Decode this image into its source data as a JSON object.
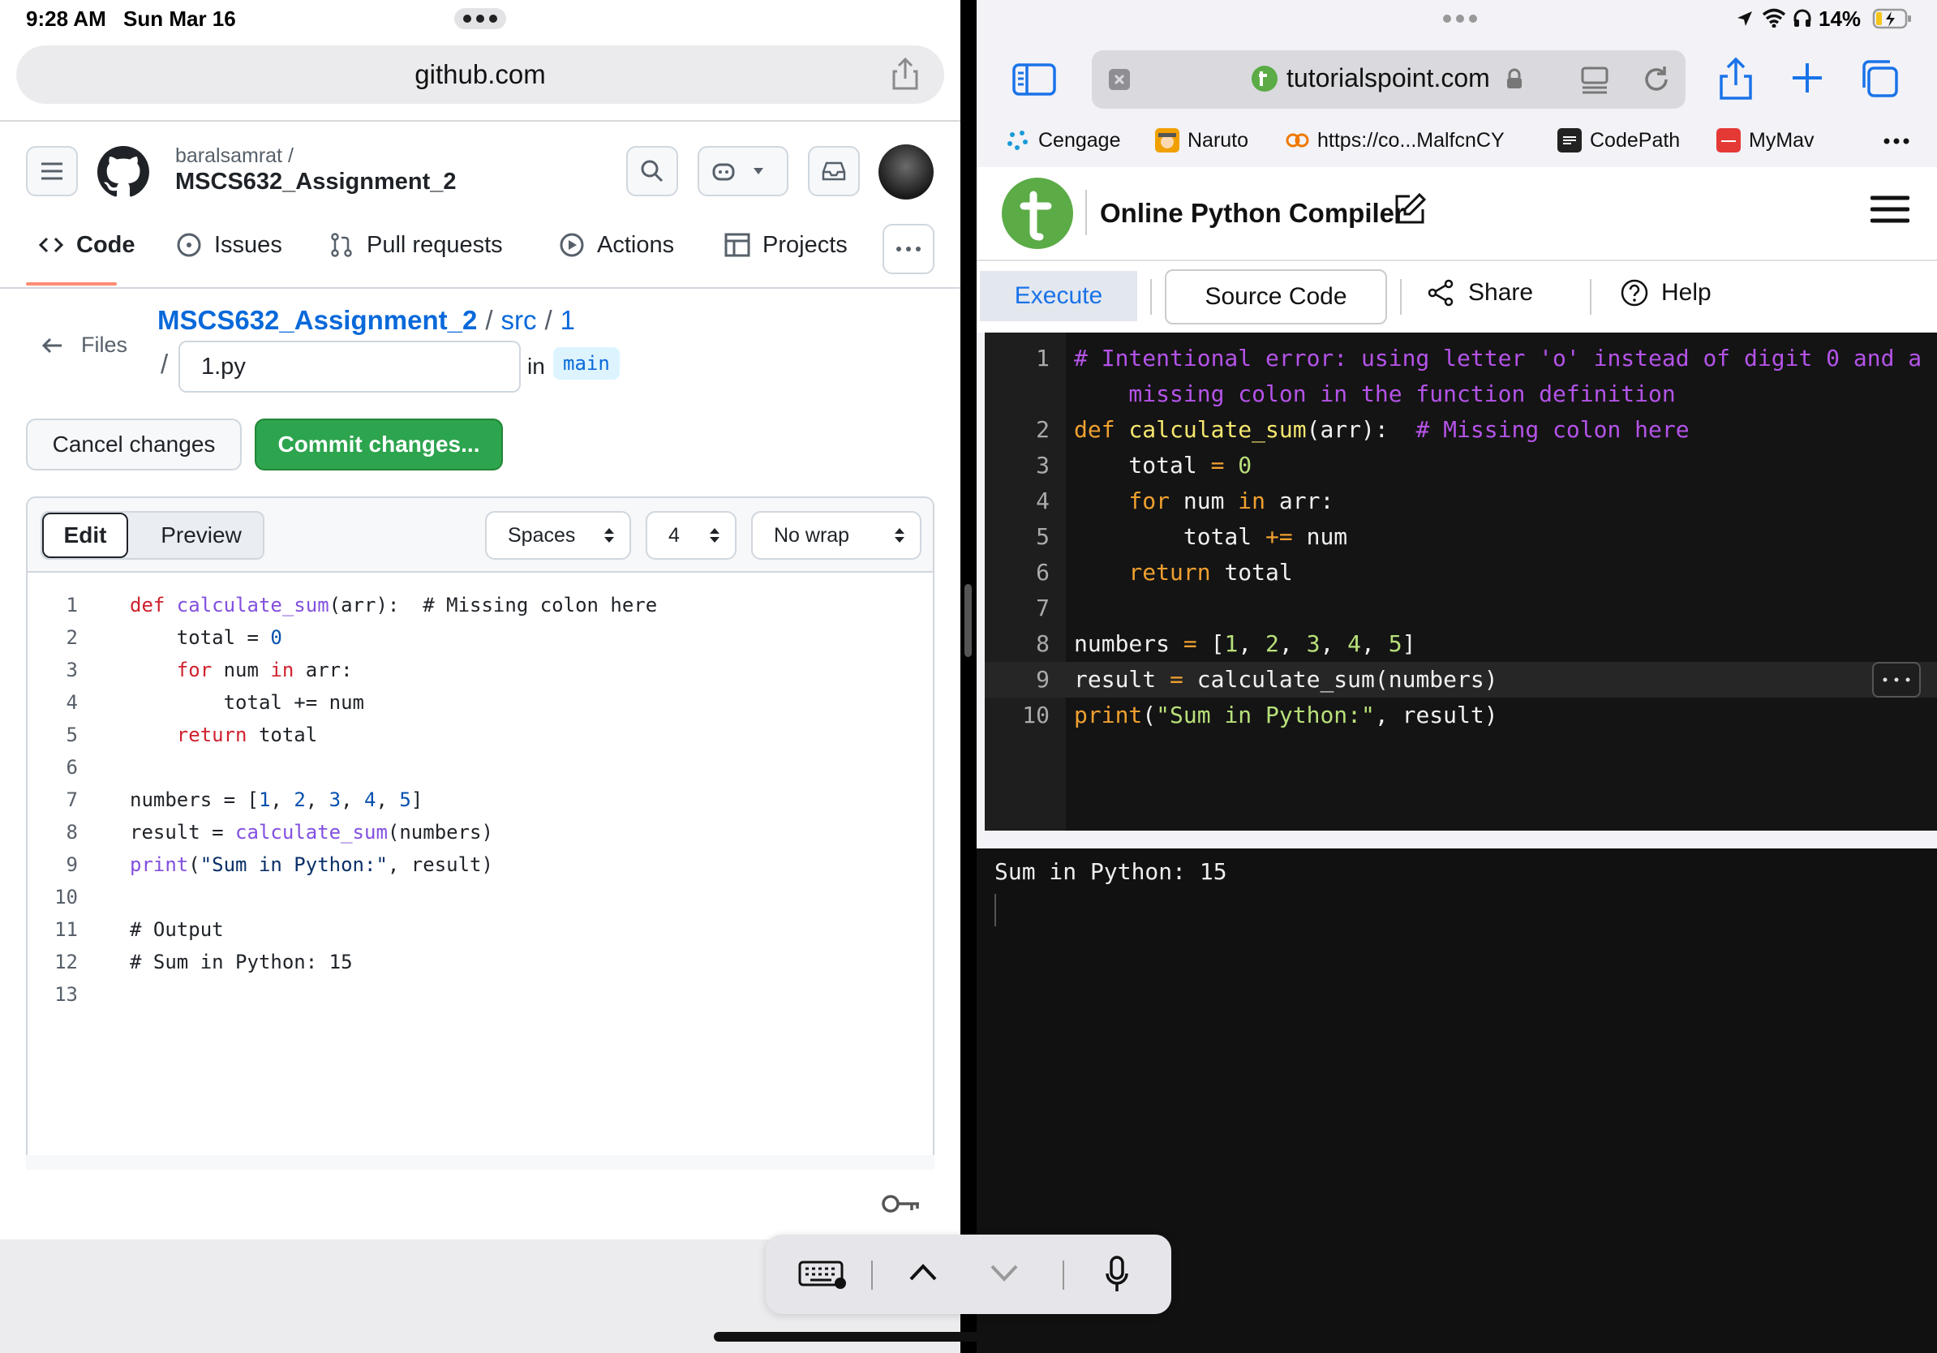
{
  "status": {
    "time": "9:28 AM",
    "date": "Sun Mar 16",
    "battery": "14%"
  },
  "left": {
    "url": "github.com",
    "repo_owner": "baralsamrat /",
    "repo_name": "MSCS632_Assignment_2",
    "tabs": [
      "Code",
      "Issues",
      "Pull requests",
      "Actions",
      "Projects"
    ],
    "files_label": "Files",
    "crumb_repo": "MSCS632_Assignment_2",
    "crumb_sep1": "/",
    "crumb_src": "src",
    "crumb_sep2": "/",
    "crumb_dir": "1",
    "crumb_sep3": "/",
    "filename": "1.py",
    "in_label": "in",
    "branch": "main",
    "cancel_label": "Cancel changes",
    "commit_label": "Commit changes...",
    "edit_label": "Edit",
    "preview_label": "Preview",
    "indent_mode": "Spaces",
    "indent_size": "4",
    "wrap_mode": "No wrap",
    "code": [
      [
        [
          "kw",
          "def "
        ],
        [
          "fn",
          "calculate_sum"
        ],
        [
          "",
          "(arr):  "
        ],
        [
          "cm",
          "# Missing colon here"
        ]
      ],
      [
        [
          "",
          "    total = "
        ],
        [
          "num",
          "0"
        ]
      ],
      [
        [
          "kw",
          "    for "
        ],
        [
          "",
          "num "
        ],
        [
          "kw",
          "in "
        ],
        [
          "",
          "arr:"
        ]
      ],
      [
        [
          "",
          "        total += num"
        ]
      ],
      [
        [
          "kw",
          "    return "
        ],
        [
          "",
          "total"
        ]
      ],
      [],
      [
        [
          "",
          "numbers = ["
        ],
        [
          "num",
          "1"
        ],
        [
          "",
          ", "
        ],
        [
          "num",
          "2"
        ],
        [
          "",
          ", "
        ],
        [
          "num",
          "3"
        ],
        [
          "",
          ", "
        ],
        [
          "num",
          "4"
        ],
        [
          "",
          ", "
        ],
        [
          "num",
          "5"
        ],
        [
          "",
          "]"
        ]
      ],
      [
        [
          "",
          "result = "
        ],
        [
          "fn",
          "calculate_sum"
        ],
        [
          "",
          "(numbers)"
        ]
      ],
      [
        [
          "fn",
          "print"
        ],
        [
          "",
          "("
        ],
        [
          "str",
          "\"Sum in Python:\""
        ],
        [
          "",
          ", result)"
        ]
      ],
      [],
      [
        [
          "cm",
          "# Output"
        ]
      ],
      [
        [
          "cm",
          "# Sum in Python: 15"
        ]
      ],
      []
    ]
  },
  "right": {
    "url": "tutorialspoint.com",
    "bookmarks": [
      "Cengage",
      "Naruto",
      "https://co...MalfcnCY",
      "CodePath",
      "MyMav"
    ],
    "site_title": "Online Python Compiler",
    "toolbar": {
      "execute": "Execute",
      "source": "Source Code",
      "share": "Share",
      "help": "Help"
    },
    "code": [
      {
        "n": "1",
        "parts": [
          [
            "tc",
            "# Intentional error: using letter 'o' instead of digit 0 and a"
          ]
        ]
      },
      {
        "n": "",
        "parts": [
          [
            "tc",
            "    missing colon in the function definition"
          ]
        ]
      },
      {
        "n": "2",
        "parts": [
          [
            "tk",
            "def "
          ],
          [
            "tf",
            "calculate_sum"
          ],
          [
            "tw",
            "(arr):  "
          ],
          [
            "tc",
            "# Missing colon here"
          ]
        ]
      },
      {
        "n": "3",
        "parts": [
          [
            "tw",
            "    total "
          ],
          [
            "tk",
            "= "
          ],
          [
            "tn",
            "0"
          ]
        ]
      },
      {
        "n": "4",
        "parts": [
          [
            "tk",
            "    for "
          ],
          [
            "tw",
            "num "
          ],
          [
            "tk",
            "in "
          ],
          [
            "tw",
            "arr:"
          ]
        ]
      },
      {
        "n": "5",
        "parts": [
          [
            "tw",
            "        total "
          ],
          [
            "tk",
            "+= "
          ],
          [
            "tw",
            "num"
          ]
        ]
      },
      {
        "n": "6",
        "parts": [
          [
            "tk",
            "    return "
          ],
          [
            "tw",
            "total"
          ]
        ]
      },
      {
        "n": "7",
        "parts": []
      },
      {
        "n": "8",
        "parts": [
          [
            "tw",
            "numbers "
          ],
          [
            "tk",
            "= "
          ],
          [
            "tw",
            "["
          ],
          [
            "tn",
            "1"
          ],
          [
            "tw",
            ", "
          ],
          [
            "tn",
            "2"
          ],
          [
            "tw",
            ", "
          ],
          [
            "tn",
            "3"
          ],
          [
            "tw",
            ", "
          ],
          [
            "tn",
            "4"
          ],
          [
            "tw",
            ", "
          ],
          [
            "tn",
            "5"
          ],
          [
            "tw",
            "]"
          ]
        ]
      },
      {
        "n": "9",
        "parts": [
          [
            "tw",
            "result "
          ],
          [
            "tk",
            "= "
          ],
          [
            "tw",
            "calculate_sum(numbers)"
          ]
        ]
      },
      {
        "n": "10",
        "parts": [
          [
            "tk",
            "print"
          ],
          [
            "tw",
            "("
          ],
          [
            "ts",
            "\"Sum in Python:\""
          ],
          [
            "tw",
            ", result)"
          ]
        ]
      }
    ],
    "output": "Sum in Python: 15"
  }
}
